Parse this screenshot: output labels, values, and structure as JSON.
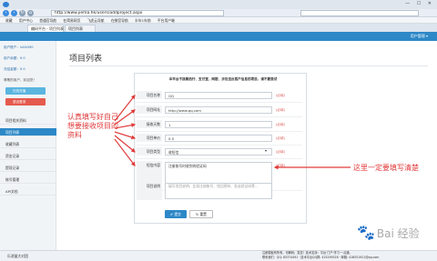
{
  "browser": {
    "url": "http://www.jiema.hk/users/addproject.aspx",
    "bookmarks": [
      "收藏",
      "用户中心",
      "首通官导航",
      "在简易网页",
      "飞虎云导航",
      "在微官导航",
      "半年1年前",
      "平台用户端"
    ],
    "tabs": [
      "编码平台 - 项目列表",
      "项目列表"
    ],
    "window_controls": "— ☐ ✕"
  },
  "topbar": {
    "user_menu": "用户管理 ▾"
  },
  "sidebar": {
    "account_label": "用户账户：",
    "account_value": "iv04490",
    "balance_label": "用户余额：",
    "balance_value": "¥ 0",
    "freeze_label": "冻结金额：",
    "freeze_value": "¥ 0",
    "welcome": "尊敬的用户，欢迎您！",
    "buttons": [
      "在线充值",
      "退出登录"
    ],
    "items": [
      "项目相关资料",
      "项目列表",
      "收藏列表",
      "资金记录",
      "提现记录",
      "账号管理",
      "API文档"
    ],
    "footer_link": "乐消量大对团"
  },
  "page": {
    "title": "项目列表",
    "hint": "本平台不接黑拍行、支付宝、网银、涉及违反客户信息的项目，请不要尝试"
  },
  "form": {
    "rows": [
      {
        "label": "项目名称",
        "value": "QQ",
        "req": "(必填)"
      },
      {
        "label": "项目网址",
        "value": "http://www.qq.com",
        "req": "(必填)"
      },
      {
        "label": "接收天数",
        "value": "1",
        "req": "(必填)"
      },
      {
        "label": "项目单价",
        "value": "0.5",
        "req": "(必填)"
      },
      {
        "label": "项目类型",
        "value": "收短信",
        "req": "(必填)"
      },
      {
        "label": "短信内容",
        "value": "注册账号时收到的验证码",
        "req": "(必填)"
      },
      {
        "label": "项目说明",
        "value": "填写项目说明，比如注册账号、找回密码、发送验证码等..."
      }
    ],
    "submit_label": "✔ 提交",
    "reset_label": "↻ 重置"
  },
  "annotations": {
    "left": "认真填写好自己想要接收项目的资料",
    "right": "这里一定要填写清楚"
  },
  "footer": {
    "line1": "注册模板有所有，可解码；发送！技术支持：平台·门户·学习·一点通。",
    "line2": "联系我们：QQ: 85374491 · 技术平台QQ群: 415299328 · 邮箱: 416551921@qq.com"
  },
  "watermark": {
    "paw": "🐾",
    "text": "Bai 经验"
  },
  "colors": {
    "topbar": "#2d88c7",
    "annotation": "#e03a3a",
    "charge_button": "#5bb5df",
    "logout_button": "#e55a4e"
  }
}
